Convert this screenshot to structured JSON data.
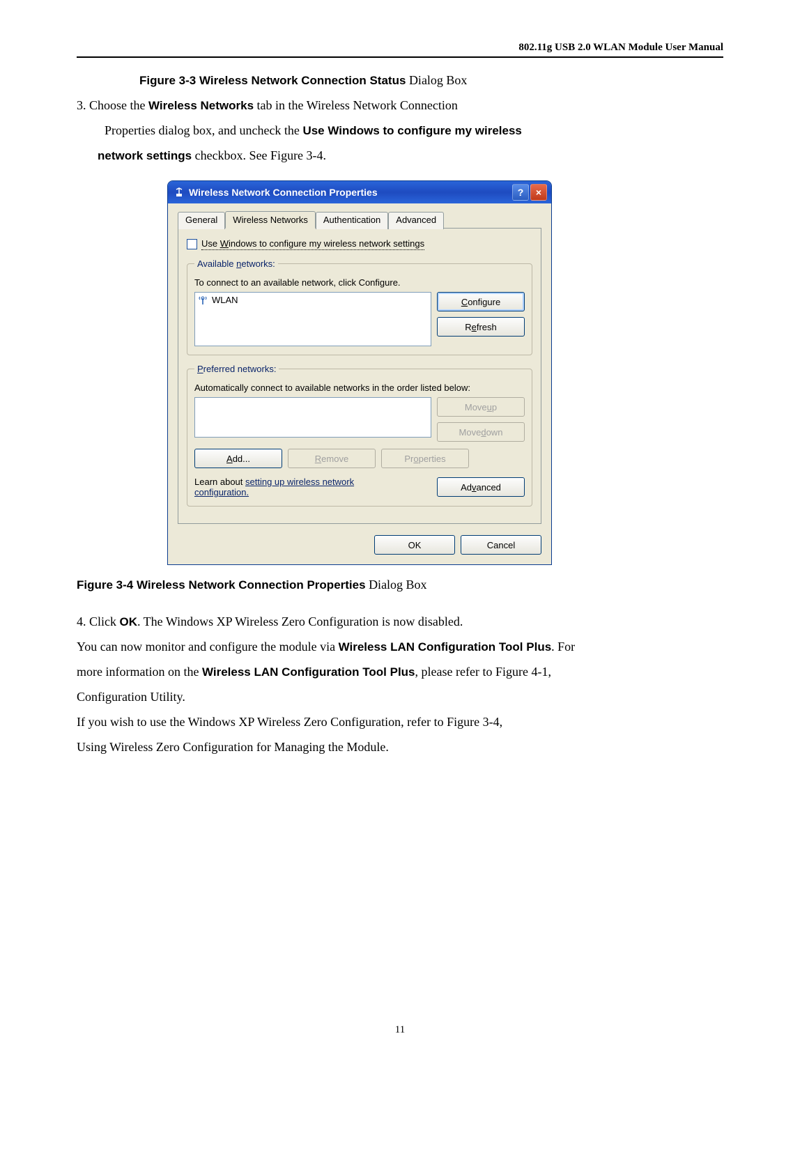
{
  "header": {
    "right": "802.11g USB 2.0 WLAN Module User Manual"
  },
  "fig33": {
    "prefix": "Figure 3-3 Wireless Network Connection Status",
    "suffix": " Dialog Box"
  },
  "step3": {
    "lead": "3. Choose the ",
    "bold1": "Wireless Networks",
    "mid1": " tab in the Wireless Network Connection",
    "line2a": "Properties dialog box, and uncheck the ",
    "bold2": "Use Windows to configure my wireless",
    "line3a": "network settings",
    "line3b": " checkbox. See Figure 3-4."
  },
  "dialog": {
    "title": "Wireless Network Connection Properties",
    "help": "?",
    "close": "×",
    "tabs": {
      "general": "General",
      "wireless": "Wireless Networks",
      "auth": "Authentication",
      "adv": "Advanced"
    },
    "checkbox_pre": "Use ",
    "checkbox_u": "W",
    "checkbox_post": "indows to configure my wireless network settings",
    "available": {
      "legend_pre": "Available ",
      "legend_u": "n",
      "legend_post": "etworks:",
      "desc": "To connect to an available network, click Configure.",
      "item": "WLAN",
      "configure_u": "C",
      "configure_post": "onfigure",
      "refresh_pre": "R",
      "refresh_u": "e",
      "refresh_post": "fresh"
    },
    "preferred": {
      "legend_u": "P",
      "legend_post": "referred networks:",
      "desc": "Automatically connect to available networks in the order listed below:",
      "moveup_pre": "Move ",
      "moveup_u": "u",
      "moveup_post": "p",
      "movedown_pre": "Move ",
      "movedown_u": "d",
      "movedown_post": "own",
      "add_u": "A",
      "add_post": "dd...",
      "remove_u": "R",
      "remove_post": "emove",
      "props_pre": "Pr",
      "props_u": "o",
      "props_post": "perties"
    },
    "learn": {
      "pre": "Learn about ",
      "link": "setting up wireless network",
      "line2": "configuration."
    },
    "advanced_pre": "Ad",
    "advanced_u": "v",
    "advanced_post": "anced",
    "ok": "OK",
    "cancel": "Cancel"
  },
  "fig34": {
    "prefix": "Figure 3-4 Wireless Network Connection Properties",
    "suffix": " Dialog Box"
  },
  "step4": {
    "lead": "4. Click ",
    "bold": "OK",
    "rest": ". The Windows XP Wireless Zero Configuration is now disabled."
  },
  "para": {
    "l1a": "You can now monitor and configure the module  via ",
    "l1b": "Wireless LAN Configuration Tool Plus",
    "l1c": ". For",
    "l2a": "more information on the ",
    "l2b": "Wireless LAN Configuration Tool Plus",
    "l2c": ", please refer to Figure 4-1,",
    "l3": "Configuration Utility.",
    "l4": "If you wish to use the Windows XP Wireless Zero Configuration, refer to Figure 3-4,",
    "l5": "Using Wireless Zero Configuration for Managing the Module."
  },
  "pagenum": "11"
}
